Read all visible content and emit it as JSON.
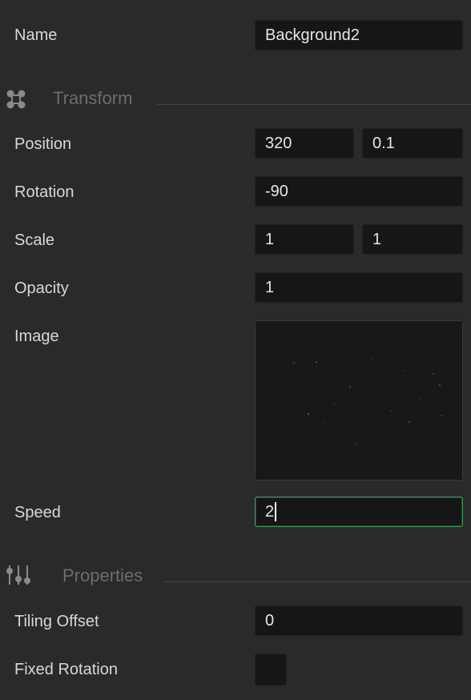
{
  "name": {
    "label": "Name",
    "value": "Background2"
  },
  "sections": {
    "transform": {
      "title": "Transform",
      "icon": "transform-icon"
    },
    "properties": {
      "title": "Properties",
      "icon": "sliders-icon"
    }
  },
  "position": {
    "label": "Position",
    "x": "320",
    "y": "0.1"
  },
  "rotation": {
    "label": "Rotation",
    "value": "-90"
  },
  "scale": {
    "label": "Scale",
    "x": "1",
    "y": "1"
  },
  "opacity": {
    "label": "Opacity",
    "value": "1"
  },
  "image": {
    "label": "Image"
  },
  "speed": {
    "label": "Speed",
    "value": "2"
  },
  "tiling_offset": {
    "label": "Tiling Offset",
    "value": "0"
  },
  "fixed_rotation": {
    "label": "Fixed Rotation",
    "checked": false
  },
  "colors": {
    "background": "#2a2a2a",
    "field": "#161616",
    "focus_accent": "#3f9a5e",
    "section_title": "#6c6c6c"
  }
}
